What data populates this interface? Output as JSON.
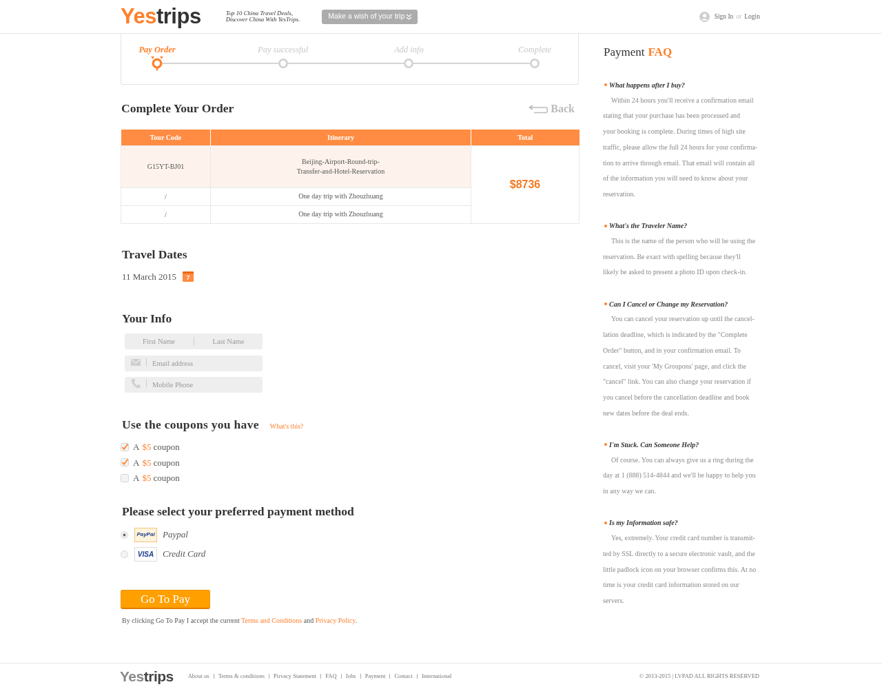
{
  "header": {
    "logo": {
      "accent": "Yes",
      "rest": "trips"
    },
    "tagline": [
      "Top 10 China Travel Deals,",
      "Discover China With YesTrips."
    ],
    "wish_select": {
      "placeholder": "Make a wish of your trip"
    },
    "account": {
      "sign_in": "Sign In",
      "separator": "or",
      "login": "Login"
    }
  },
  "progress": {
    "steps": [
      {
        "label": "Pay Order",
        "current": true
      },
      {
        "label": "Pay successful",
        "current": false
      },
      {
        "label": "Add info",
        "current": false
      },
      {
        "label": "Complete",
        "current": false
      }
    ]
  },
  "order": {
    "title": "Complete Your Order",
    "back": "Back",
    "table": {
      "columns": [
        "Tour Code",
        "Itinerary",
        "Total"
      ],
      "rows": [
        {
          "tour_code": "G15YT-BJ01",
          "itinerary": "Beijing-Airport-Round-trip-Transfer-and-Hotel-Reservation",
          "highlighted": true
        },
        {
          "tour_code": "/",
          "itinerary": "One day trip with Zhouzhuang",
          "highlighted": false
        },
        {
          "tour_code": "/",
          "itinerary": "One day trip with Zhouzhuang",
          "highlighted": false
        }
      ],
      "total": "$8736"
    }
  },
  "travel_dates": {
    "title": "Travel Dates",
    "date": "11 March 2015",
    "calendar_day": "7"
  },
  "your_info": {
    "title": "Your Info",
    "first_name": {
      "placeholder": "First Name"
    },
    "last_name": {
      "placeholder": "Last Name"
    },
    "email": {
      "placeholder": "Email address"
    },
    "phone": {
      "placeholder": "Mobile Phone"
    }
  },
  "coupons": {
    "title": "Use the coupons you have",
    "help_link": "What's this?",
    "items": [
      {
        "prefix": "A",
        "amount": "$5",
        "suffix": "coupon",
        "checked": true
      },
      {
        "prefix": "A",
        "amount": "$5",
        "suffix": "coupon",
        "checked": true
      },
      {
        "prefix": "A",
        "amount": "$5",
        "suffix": "coupon",
        "checked": false
      }
    ]
  },
  "payment": {
    "title": "Please select your preferred payment method",
    "methods": [
      {
        "kind": "paypal",
        "logo_text": "PayPal",
        "label": "Paypal",
        "selected": true
      },
      {
        "kind": "visa",
        "logo_text": "VISA",
        "label": "Credit Card",
        "selected": false
      }
    ],
    "submit": "Go To Pay",
    "notice": [
      {
        "kind": "text",
        "text": "By clicking Go To Pay I accept the current "
      },
      {
        "kind": "link",
        "text": "Terms and Conditions"
      },
      {
        "kind": "text",
        "text": " and "
      },
      {
        "kind": "link",
        "text": "Privacy Policy"
      },
      {
        "kind": "text",
        "text": "."
      }
    ]
  },
  "faq": {
    "title": "Payment",
    "title_accent": "FAQ",
    "items": [
      {
        "question": "What happens after I buy?",
        "answer_lines": [
          "Within 24 hours you'll receive a confirmation email",
          "stating that your purchase has been processed and",
          "your booking is complete. During times of high site",
          "traffic, please allow the full 24 hours for your confirma-",
          "tion to arrive through email. That email will contain all",
          "of the information you will need to know about your",
          "reservation."
        ]
      },
      {
        "question": "What's the Traveler Name?",
        "answer_lines": [
          "This is the name of the person who will be using the",
          "reservation. Be exact with spelling because they'll",
          "likely be asked to present a photo ID upon check-in."
        ]
      },
      {
        "question": "Can I Cancel or Change my Reservation?",
        "answer_lines": [
          "You can cancel your reservation up until the cancel-",
          "lation deadline, which is indicated by the \"Complete",
          "Order\" button, and in your confirmation email. To",
          "cancel, visit your 'My Groupons' page, and click the",
          "\"cancel\" link. You can also change your reservation if",
          "you cancel before the cancellation deadline and book",
          "new dates before the deal ends."
        ]
      },
      {
        "question": "I'm Stuck. Can Someone Help?",
        "answer_lines": [
          "Of course. You can always give us a ring during the",
          "day at 1 (888) 514-4844 and we'll be happy to help you",
          "in any way we can."
        ]
      },
      {
        "question": "Is my Information safe?",
        "answer_lines": [
          "Yes, extremely. Your credit card number is transmit-",
          "ted by SSL directly to a secure electronic vault, and the",
          "little padlock icon on your browser confirms this. At no",
          "time is your credit card information stored on our",
          "servers."
        ]
      }
    ]
  },
  "footer": {
    "logo": {
      "accent": "Yes",
      "rest": "trips"
    },
    "links": [
      "About us",
      "Terms & conditions",
      "Pirvacy Statement",
      "FAQ",
      "Jobs",
      "Payment",
      "Contact",
      "International"
    ],
    "copyright": "© 2013-2015 | LVPAD ALL RIGHTS RESERVED"
  }
}
